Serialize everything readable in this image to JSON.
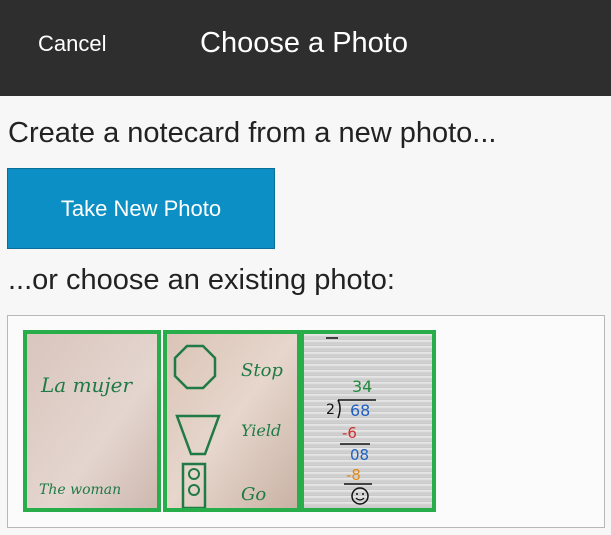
{
  "header": {
    "cancel_label": "Cancel",
    "title": "Choose a Photo"
  },
  "main": {
    "new_photo_prompt": "Create a notecard from a new photo...",
    "take_photo_label": "Take New Photo",
    "existing_prompt": "...or choose an existing photo:"
  },
  "photos": [
    {
      "top_text": "La mujer",
      "bottom_text": "The woman"
    },
    {
      "labels": [
        "Stop",
        "Yield",
        "Go"
      ]
    },
    {
      "lines": [
        "34",
        "2",
        "68",
        "-6",
        "08",
        "-8"
      ]
    }
  ],
  "colors": {
    "header_bg": "#2e2e2e",
    "button_bg": "#0c8fc4",
    "selection_border": "#27ad4a"
  }
}
